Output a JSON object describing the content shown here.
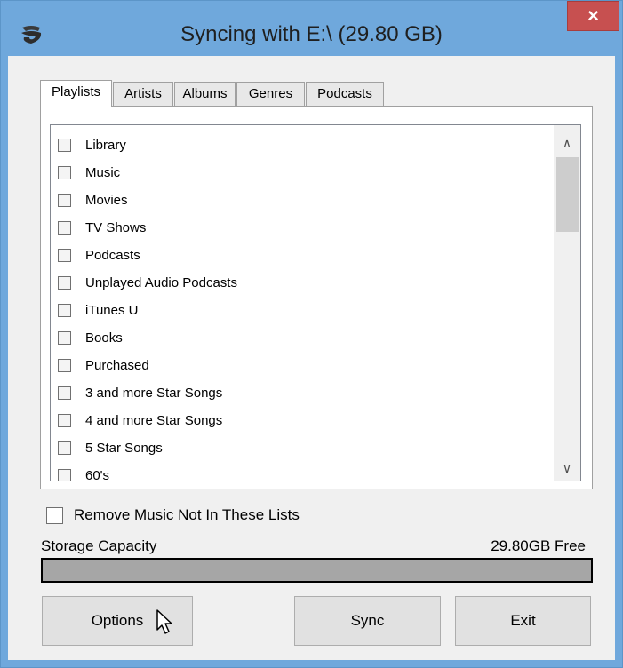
{
  "window": {
    "title": "Syncing with E:\\ (29.80 GB)",
    "close_label": "×"
  },
  "tabs": [
    {
      "label": "Playlists",
      "active": true
    },
    {
      "label": "Artists",
      "active": false
    },
    {
      "label": "Albums",
      "active": false
    },
    {
      "label": "Genres",
      "active": false
    },
    {
      "label": "Podcasts",
      "active": false
    }
  ],
  "playlists": [
    "Library",
    "Music",
    "Movies",
    "TV Shows",
    "Podcasts",
    "Unplayed Audio Podcasts",
    "iTunes U",
    "Books",
    "Purchased",
    "3 and more Star Songs",
    "4 and more Star Songs",
    "5 Star Songs",
    "60's"
  ],
  "options": {
    "remove_label": "Remove Music Not In These Lists"
  },
  "storage": {
    "label": "Storage Capacity",
    "free_text": "29.80GB Free",
    "used_fraction": 1.0
  },
  "buttons": {
    "options": "Options",
    "sync": "Sync",
    "exit": "Exit"
  },
  "colors": {
    "frame": "#6fa8dc",
    "close": "#c75050"
  }
}
